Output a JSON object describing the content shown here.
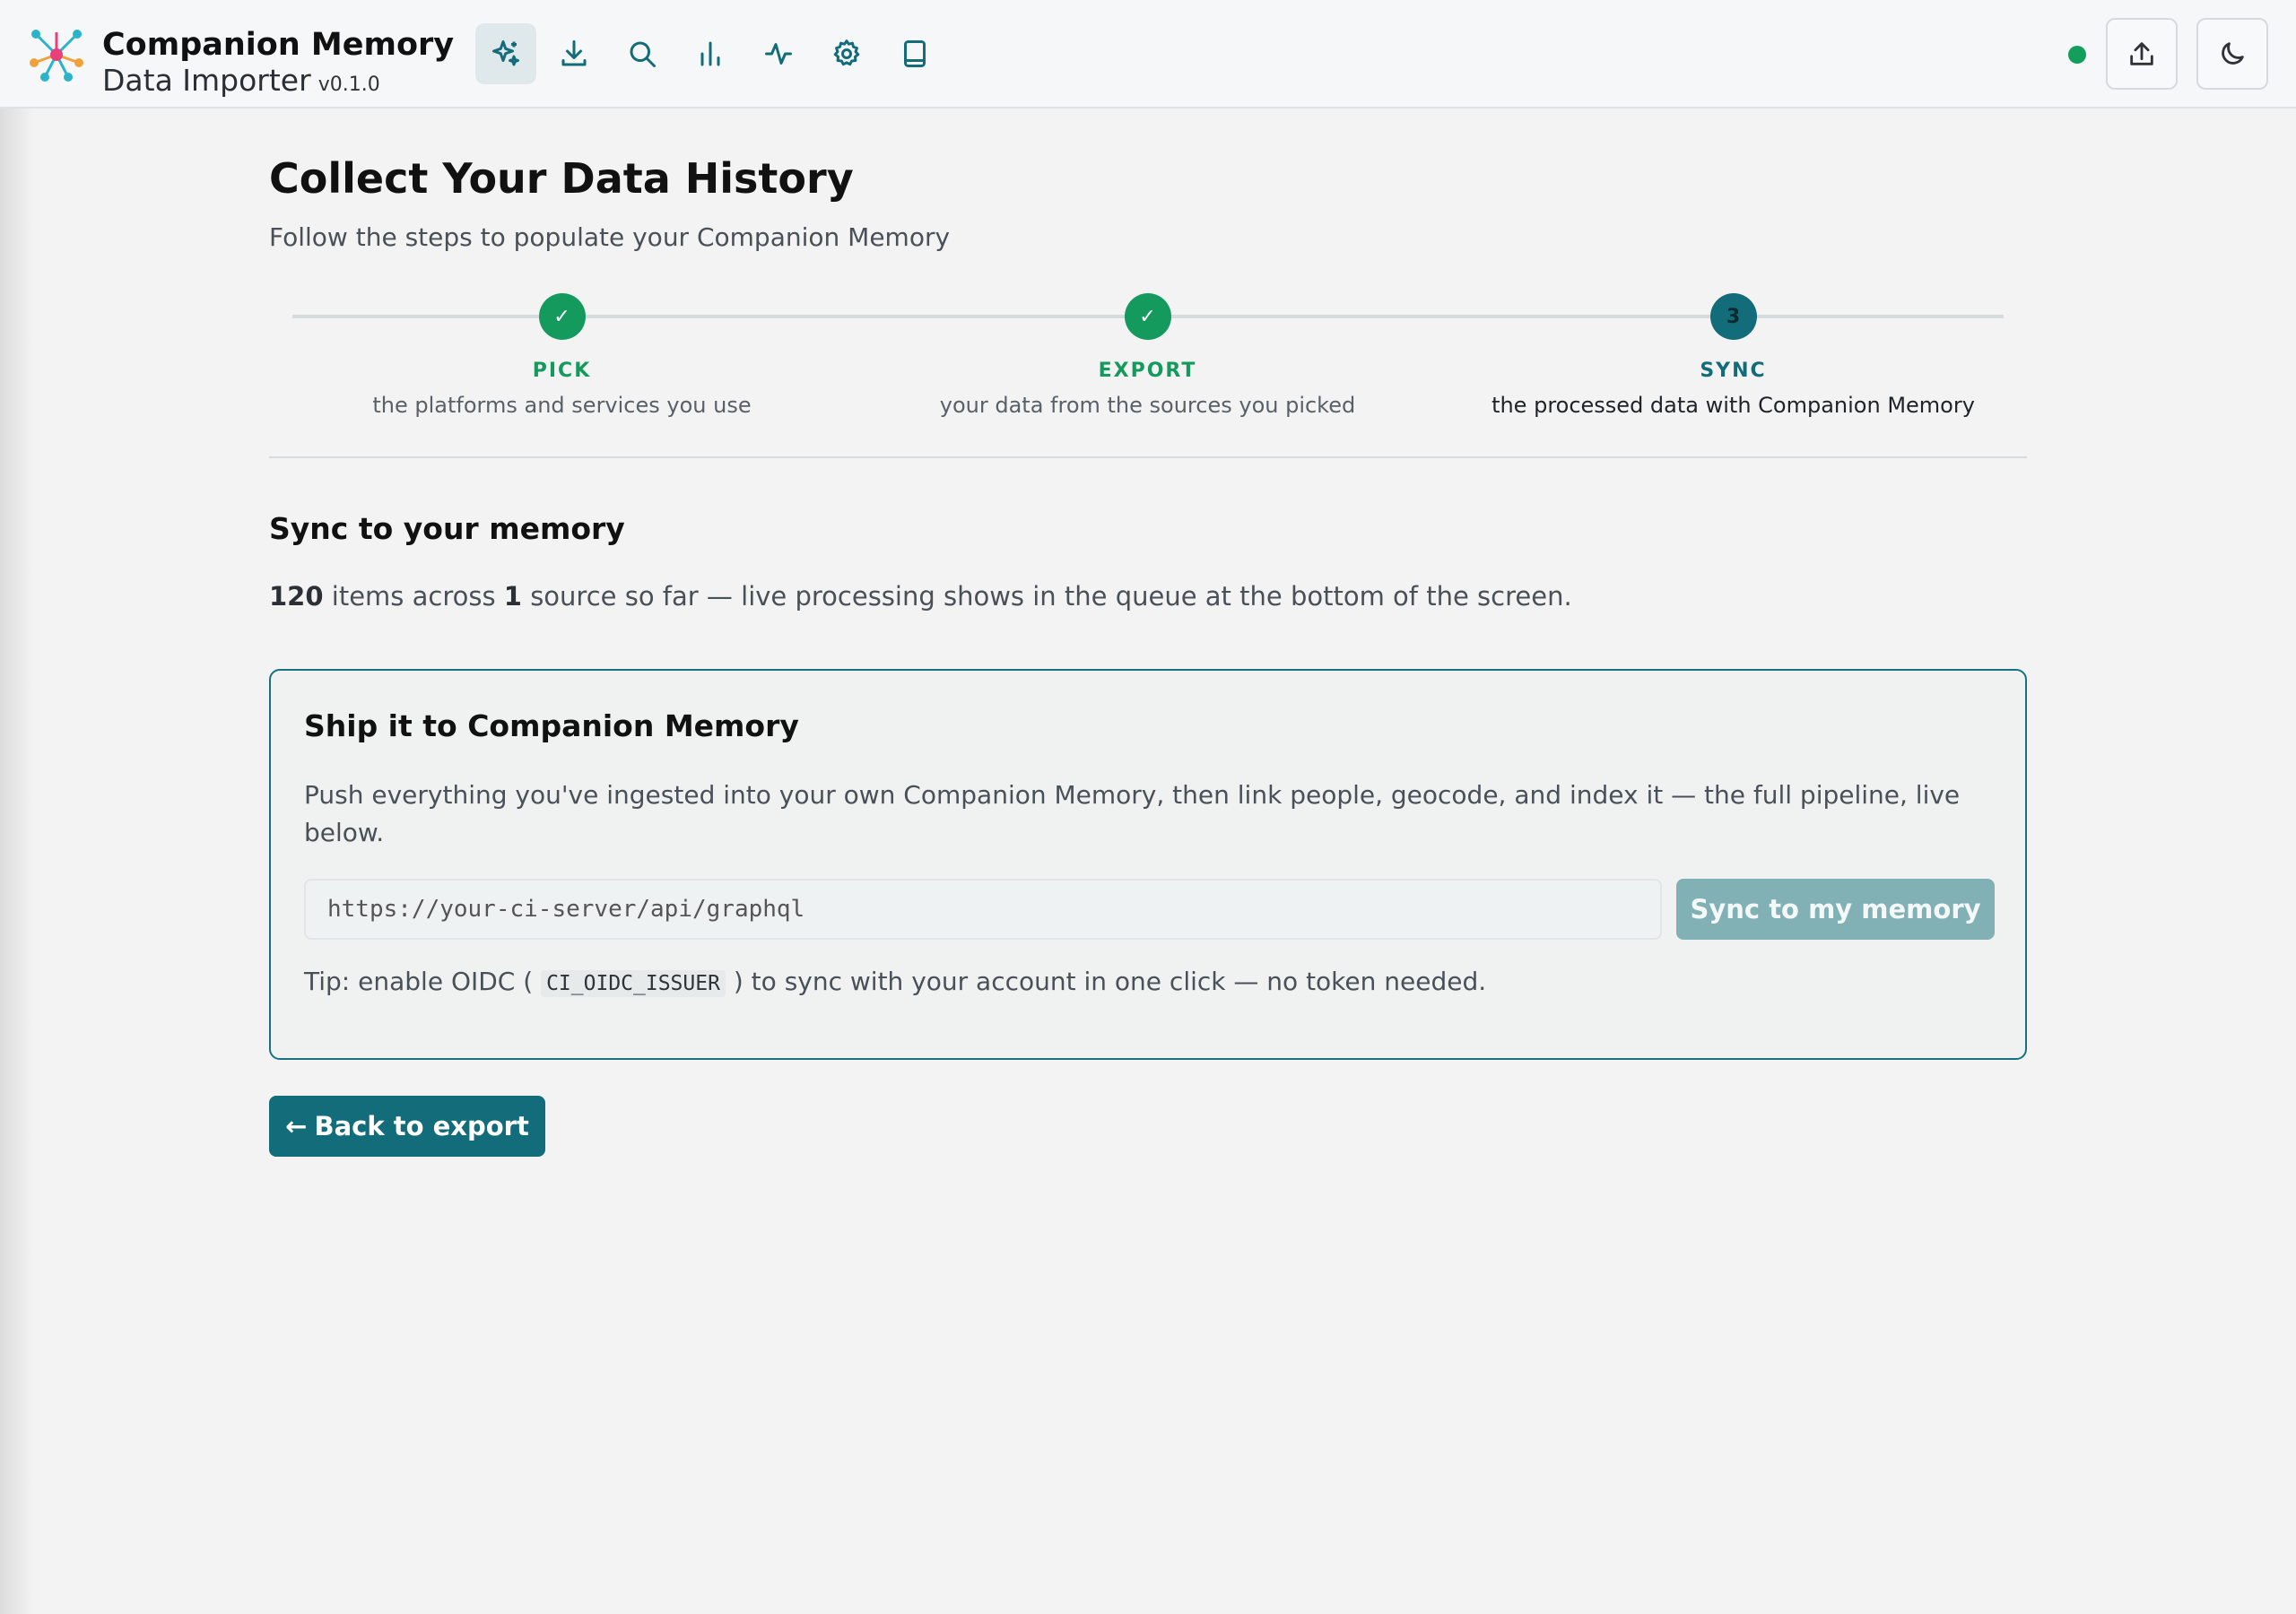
{
  "app": {
    "title": "Companion Memory",
    "subtitle": "Data Importer",
    "version": "v0.1.0"
  },
  "nav": {
    "items": [
      {
        "name": "sparkle-icon",
        "active": true
      },
      {
        "name": "download-icon",
        "active": false
      },
      {
        "name": "search-icon",
        "active": false
      },
      {
        "name": "bar-chart-icon",
        "active": false
      },
      {
        "name": "activity-icon",
        "active": false
      },
      {
        "name": "gear-icon",
        "active": false
      },
      {
        "name": "book-icon",
        "active": false
      }
    ]
  },
  "header_actions": {
    "status_color": "#149e5c",
    "upload_icon": "upload-icon",
    "theme_icon": "moon-icon"
  },
  "page": {
    "title": "Collect Your Data History",
    "subtitle": "Follow the steps to populate your Companion Memory"
  },
  "steps": [
    {
      "label": "PICK",
      "desc": "the platforms and services you use",
      "state": "done"
    },
    {
      "label": "EXPORT",
      "desc": "your data from the sources you picked",
      "state": "done"
    },
    {
      "label": "SYNC",
      "desc": "the processed data with Companion Memory",
      "state": "current",
      "number": "3"
    }
  ],
  "sync": {
    "section_title": "Sync to your memory",
    "item_count": "120",
    "summary_mid": " items across ",
    "source_count": "1",
    "summary_end": " source so far — live processing shows in the queue at the bottom of the screen."
  },
  "card": {
    "title": "Ship it to Companion Memory",
    "description": "Push everything you've ingested into your own Companion Memory, then link people, geocode, and index it — the full pipeline, live below.",
    "url_placeholder": "https://your-ci-server/api/graphql",
    "sync_button": "Sync to my memory",
    "tip_prefix": "Tip: enable OIDC ( ",
    "tip_code": "CI_OIDC_ISSUER",
    "tip_suffix": " ) to sync with your account in one click — no token needed."
  },
  "back_button": "Back to export",
  "colors": {
    "accent": "#136c79",
    "success": "#159a5e",
    "sync_button_disabled": "#82b1b5"
  }
}
